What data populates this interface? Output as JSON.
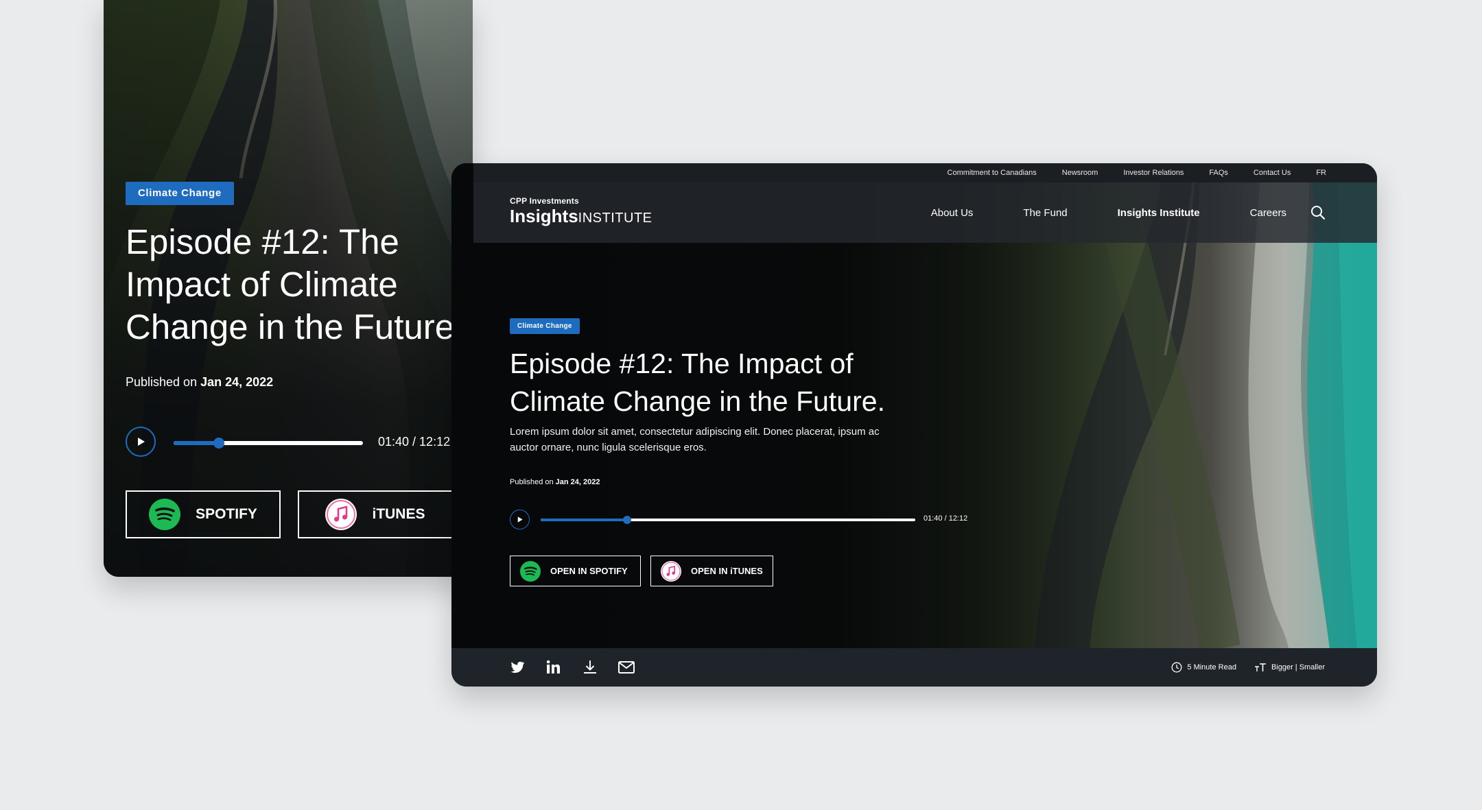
{
  "colors": {
    "accent": "#1e6cc0",
    "spotify": "#1db954",
    "background": "#eaebed",
    "nav_bar": "#24282e",
    "share_bar": "#1e242a"
  },
  "mobile": {
    "badge": "Climate Change",
    "title": "Episode #12: The Impact of Climate Change in the Future.",
    "published_prefix": "Published on",
    "published_date": "Jan 24, 2022",
    "player": {
      "time": "01:40 / 12:12",
      "progress": 0.24
    },
    "buttons": {
      "spotify": "SPOTIFY",
      "itunes": "iTUNES"
    }
  },
  "desktop": {
    "utility_nav": [
      "Commitment to Canadians",
      "Newsroom",
      "Investor Relations",
      "FAQs",
      "Contact Us",
      "FR"
    ],
    "brand": {
      "top": "CPP Investments",
      "main_bold": "Insights",
      "main_light": "INSTITUTE"
    },
    "main_nav": [
      {
        "label": "About Us",
        "active": false
      },
      {
        "label": "The Fund",
        "active": false
      },
      {
        "label": "Insights Institute",
        "active": true
      },
      {
        "label": "Careers",
        "active": false
      }
    ],
    "search_icon": "search-icon",
    "badge": "Climate Change",
    "title": "Episode #12: The Impact of Climate Change in the Future.",
    "description": "Lorem ipsum dolor sit amet, consectetur adipiscing elit. Donec placerat, ipsum ac auctor ornare, nunc ligula scelerisque eros.",
    "published_prefix": "Published on",
    "published_date": "Jan 24, 2022",
    "player": {
      "time": "01:40 / 12:12",
      "progress": 0.23
    },
    "buttons": {
      "spotify": "OPEN IN SPOTIFY",
      "itunes": "OPEN IN iTUNES"
    },
    "share_icons": [
      "twitter-icon",
      "linkedin-icon",
      "download-icon",
      "email-icon"
    ],
    "read_time": "5 Minute Read",
    "text_size": "Bigger | Smaller"
  }
}
